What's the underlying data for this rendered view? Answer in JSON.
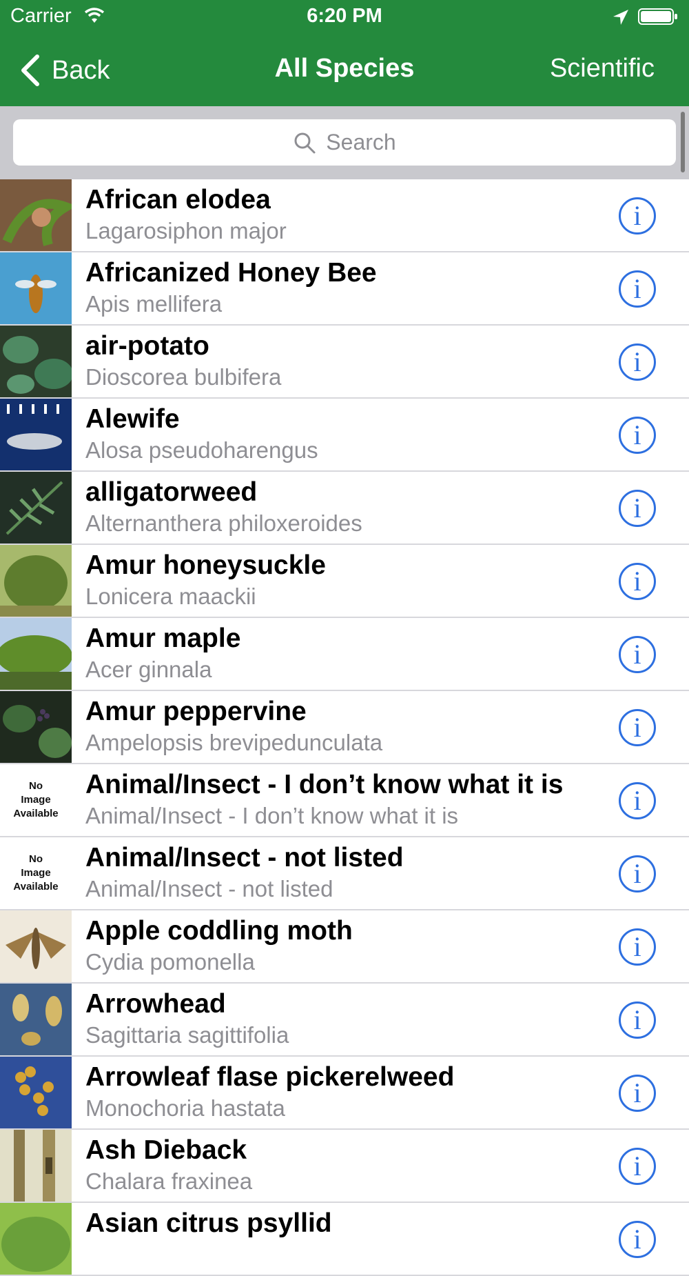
{
  "status_bar": {
    "carrier": "Carrier",
    "time": "6:20 PM"
  },
  "nav": {
    "back_label": "Back",
    "title": "All Species",
    "right_button": "Scientific"
  },
  "search": {
    "placeholder": "Search"
  },
  "colors": {
    "nav_background": "#248a3d",
    "info_accent": "#2d6fe0",
    "subtitle_gray": "#8e8e93"
  },
  "no_image_text": [
    "No",
    "Image",
    "Available"
  ],
  "species": [
    {
      "name": "African elodea",
      "scientific": "Lagarosiphon major"
    },
    {
      "name": "Africanized Honey Bee",
      "scientific": "Apis mellifera"
    },
    {
      "name": "air-potato",
      "scientific": "Dioscorea bulbifera"
    },
    {
      "name": "Alewife",
      "scientific": "Alosa pseudoharengus"
    },
    {
      "name": "alligatorweed",
      "scientific": "Alternanthera philoxeroides"
    },
    {
      "name": "Amur honeysuckle",
      "scientific": "Lonicera maackii"
    },
    {
      "name": "Amur maple",
      "scientific": "Acer ginnala"
    },
    {
      "name": "Amur peppervine",
      "scientific": "Ampelopsis brevipedunculata"
    },
    {
      "name": "Animal/Insect - I don’t know what it is",
      "scientific": "Animal/Insect - I don’t know what it is"
    },
    {
      "name": "Animal/Insect - not listed",
      "scientific": "Animal/Insect - not listed"
    },
    {
      "name": "Apple coddling moth",
      "scientific": "Cydia pomonella"
    },
    {
      "name": "Arrowhead",
      "scientific": "Sagittaria sagittifolia"
    },
    {
      "name": "Arrowleaf flase pickerelweed",
      "scientific": "Monochoria hastata"
    },
    {
      "name": "Ash Dieback",
      "scientific": "Chalara fraxinea"
    },
    {
      "name": "Asian citrus psyllid",
      "scientific": ""
    }
  ]
}
